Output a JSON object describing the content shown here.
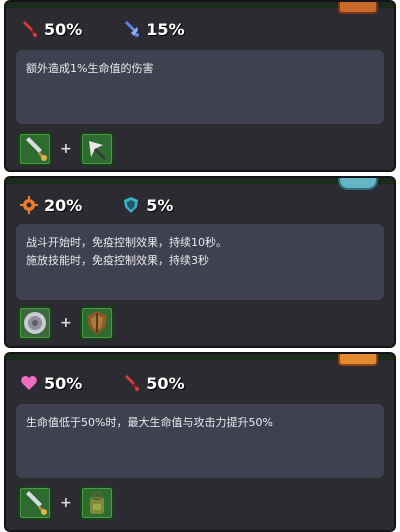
{
  "cards": [
    {
      "title_stub": "",
      "stats": [
        {
          "icon": "sword-icon",
          "value": "50%",
          "color": "#d83b3b"
        },
        {
          "icon": "blue-sword-icon",
          "value": "15%",
          "color": "#5a88f0"
        }
      ],
      "description": [
        "额外造成1%生命值的伤害"
      ],
      "recipe": [
        "green-sword-item-icon",
        "arrowhead-item-icon"
      ]
    },
    {
      "title_stub": "",
      "stats": [
        {
          "icon": "gear-burst-icon",
          "value": "20%",
          "color": "#f07b2a"
        },
        {
          "icon": "shield-icon",
          "value": "5%",
          "color": "#39b0c8"
        }
      ],
      "description": [
        "战斗开始时，免疫控制效果，持续10秒。",
        "施放技能时，免疫控制效果，持续3秒"
      ],
      "recipe": [
        "round-shield-item-icon",
        "wooden-shield-item-icon"
      ]
    },
    {
      "title_stub": "",
      "stats": [
        {
          "icon": "heart-icon",
          "value": "50%",
          "color": "#f06ec0"
        },
        {
          "icon": "sword-icon",
          "value": "50%",
          "color": "#d83b3b"
        }
      ],
      "description": [
        "生命值低于50%时，最大生命值与攻击力提升50%"
      ],
      "recipe": [
        "green-sword-item-icon",
        "backpack-item-icon"
      ]
    }
  ],
  "colors": {
    "panel_bg": "#2b2b31",
    "desc_bg": "#3f4150",
    "item_slot_bg": "#2e6b2f",
    "title_gold": "#f2b136"
  }
}
